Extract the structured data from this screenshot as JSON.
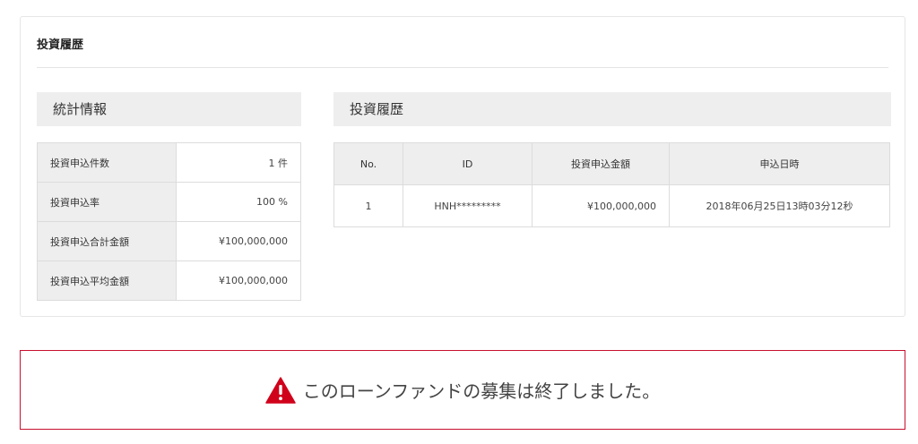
{
  "card": {
    "title": "投資履歴"
  },
  "stats": {
    "heading": "統計情報",
    "rows": [
      {
        "label": "投資申込件数",
        "value": "1 件"
      },
      {
        "label": "投資申込率",
        "value": "100 %"
      },
      {
        "label": "投資申込合計金額",
        "value": "¥100,000,000"
      },
      {
        "label": "投資申込平均金額",
        "value": "¥100,000,000"
      }
    ]
  },
  "history": {
    "heading": "投資履歴",
    "columns": [
      "No.",
      "ID",
      "投資申込金額",
      "申込日時"
    ],
    "rows": [
      {
        "no": "1",
        "id": "HNH*********",
        "amount": "¥100,000,000",
        "datetime": "2018年06月25日13時03分12秒"
      }
    ]
  },
  "notice": {
    "icon": "warning-icon",
    "text": "このローンファンドの募集は終了しました。",
    "border_color": "#c8102e",
    "icon_color": "#d0021b"
  }
}
